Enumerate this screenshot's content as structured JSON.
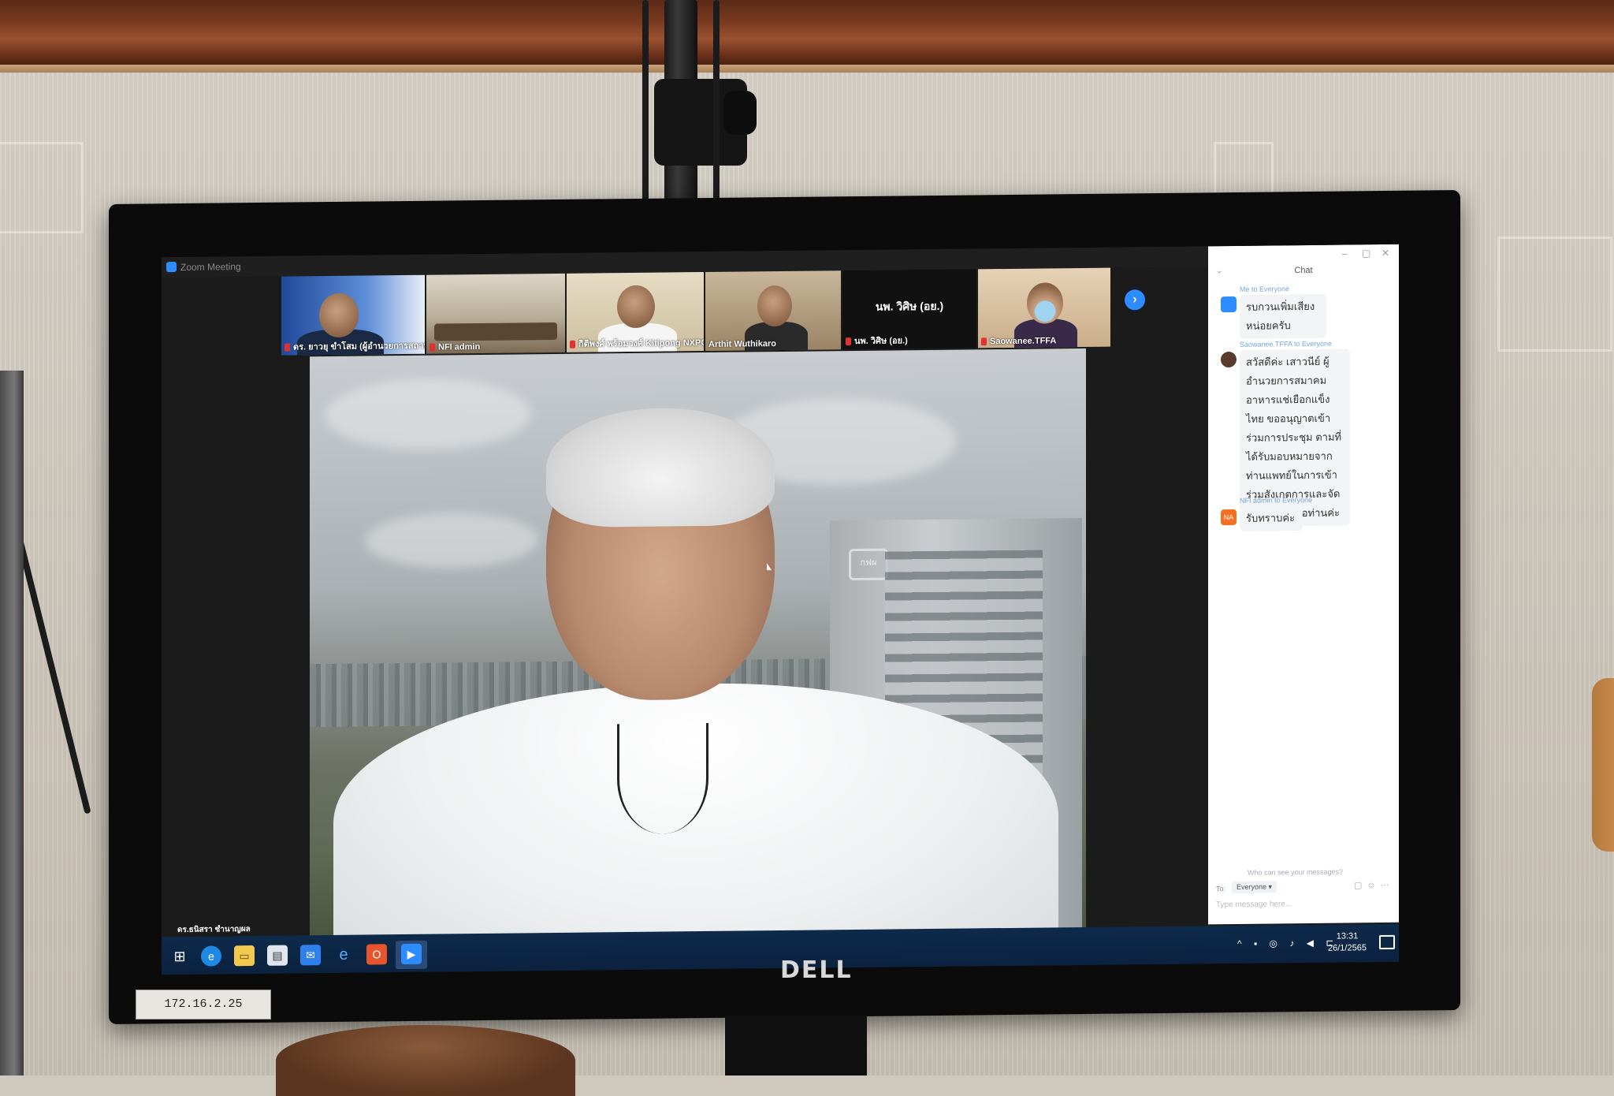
{
  "window": {
    "title": "Zoom Meeting"
  },
  "participants": [
    {
      "name": "ดร. ยาวยุ ขำโสม (ผู้อำนวยการสถาบันอาหาร)"
    },
    {
      "name": "NFI admin"
    },
    {
      "name": "กิติพงศ์ พร้อมวงศ์ Kitipong NXPO"
    },
    {
      "name": "Arthit Wuthikaro"
    },
    {
      "name": "นพ. วิศิษ (อย.)",
      "video_label": "นพ. วิศิษ (อย.)"
    },
    {
      "name": "Saowanee.TFFA"
    }
  ],
  "chat": {
    "header": "Chat",
    "messages": [
      {
        "from": "Me to Everyone",
        "avatar": "",
        "avatar_color": "#2d8cff",
        "text": "รบกวนเพิ่มเสียงหน่อยครับ"
      },
      {
        "from": "Saowanee.TFFA to Everyone",
        "avatar": "",
        "avatar_color": "#5a3b2e",
        "text": "สวัสดีค่ะ เสาวนีย์ ผู้อำนวยการสมาคมอาหารแช่เยือกแข็งไทย ขออนุญาตเข้าร่วมการประชุม ตามที่ได้รับมอบหมายจากท่านแพทย์ในการเข้าร่วมสังเกตการและจัดทำบันทึกเสนอท่านค่ะ"
      },
      {
        "from": "NFI admin to Everyone",
        "avatar": "NA",
        "avatar_color": "#f37021",
        "text": "รับทราบค่ะ"
      }
    ],
    "privacy": "Who can see your messages?",
    "to_label": "To:",
    "to_value": "Everyone ▾",
    "input_placeholder": "Type message here..."
  },
  "self_label": "ดร.ธนิสรา ชำนาญผล",
  "taskbar": {
    "clock_time": "13:31",
    "clock_date": "26/1/2565"
  },
  "monitor": {
    "brand": "DELL",
    "sticker": "172.16.2.25"
  },
  "video": {
    "building_logo": "กฟผ"
  }
}
